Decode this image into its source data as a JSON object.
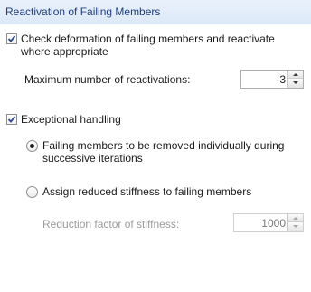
{
  "section": {
    "title": "Reactivation of Failing Members"
  },
  "check_deformation": {
    "checked": true,
    "label_line1": "Check deformation of failing members and reactivate",
    "label_line2": "where appropriate"
  },
  "max_reactivations": {
    "label": "Maximum number of reactivations:",
    "value": "3"
  },
  "exceptional_handling": {
    "checked": true,
    "label": "Exceptional handling"
  },
  "options": {
    "remove_individually": {
      "selected": true,
      "label_line1": "Failing members to be removed individually during",
      "label_line2": "successive iterations"
    },
    "reduced_stiffness": {
      "selected": false,
      "label": "Assign reduced stiffness to failing members"
    }
  },
  "reduction_factor": {
    "label": "Reduction factor of stiffness:",
    "value": "1000",
    "enabled": false
  },
  "colors": {
    "header_text": "#1f3f7a",
    "check_mark": "#2b4a8a",
    "disabled_text": "#9a9a9a"
  },
  "icons": {
    "checkbox_checked": "check-mark",
    "radio_selected": "radio-dot",
    "spin_up": "arrow-up",
    "spin_down": "arrow-down"
  }
}
